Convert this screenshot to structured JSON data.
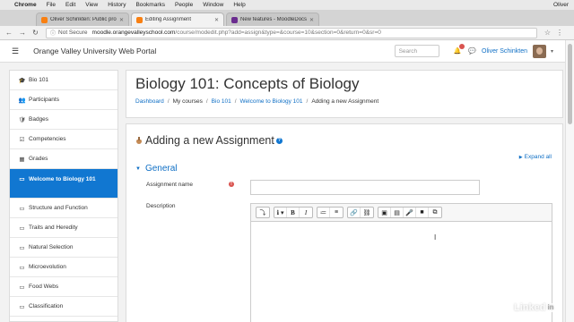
{
  "menubar": {
    "app": "Chrome",
    "items": [
      "File",
      "Edit",
      "View",
      "History",
      "Bookmarks",
      "People",
      "Window",
      "Help"
    ],
    "user": "Oliver"
  },
  "tabs": [
    {
      "label": "Oliver Schinkten: Public profile",
      "active": false
    },
    {
      "label": "Editing Assignment",
      "active": true
    },
    {
      "label": "New features - MoodleDocs",
      "active": false
    }
  ],
  "address": {
    "security": "Not Secure",
    "host": "moodle.orangevalleyschool.com",
    "path": "/course/modedit.php?add=assign&type=&course=10&section=0&return=0&sr=0"
  },
  "navbar": {
    "site_name": "Orange Valley University Web Portal",
    "search_placeholder": "Search",
    "user_name": "Oliver Schinkten"
  },
  "sidebar": {
    "items": [
      {
        "label": "Bio 101",
        "icon": "graduation-cap-icon",
        "glyph": "🎓"
      },
      {
        "label": "Participants",
        "icon": "users-icon",
        "glyph": "👥"
      },
      {
        "label": "Badges",
        "icon": "shield-icon",
        "glyph": "🛡"
      },
      {
        "label": "Competencies",
        "icon": "check-square-icon",
        "glyph": "☑"
      },
      {
        "label": "Grades",
        "icon": "table-icon",
        "glyph": "▦"
      },
      {
        "label": "Welcome to Biology 101",
        "icon": "folder-icon",
        "glyph": "▭",
        "active": true
      },
      {
        "label": "Structure and Function",
        "icon": "folder-icon",
        "glyph": "▭"
      },
      {
        "label": "Traits and Heredity",
        "icon": "folder-icon",
        "glyph": "▭"
      },
      {
        "label": "Natural Selection",
        "icon": "folder-icon",
        "glyph": "▭"
      },
      {
        "label": "Microevolution",
        "icon": "folder-icon",
        "glyph": "▭"
      },
      {
        "label": "Food Webs",
        "icon": "folder-icon",
        "glyph": "▭"
      },
      {
        "label": "Classification",
        "icon": "folder-icon",
        "glyph": "▭"
      }
    ]
  },
  "header": {
    "course_title": "Biology 101: Concepts of Biology",
    "breadcrumb": [
      "Dashboard",
      "My courses",
      "Bio 101",
      "Welcome to Biology 101",
      "Adding a new Assignment"
    ]
  },
  "form": {
    "heading": "Adding a new Assignment",
    "expand_all": "Expand all",
    "section": "General",
    "name_label": "Assignment name",
    "description_label": "Description"
  },
  "toolbar": {
    "buttons": [
      "⤵",
      "ℹ ▾",
      "B",
      "I",
      "≔",
      "≡",
      "🔗",
      "⛓",
      "▣",
      "▤",
      "🎤",
      "■",
      "⧉"
    ]
  },
  "watermark": {
    "text": "Linked",
    "in": "in"
  },
  "colors": {
    "accent": "#1177d1",
    "link": "#0f6fc5",
    "required": "#d9534f"
  }
}
